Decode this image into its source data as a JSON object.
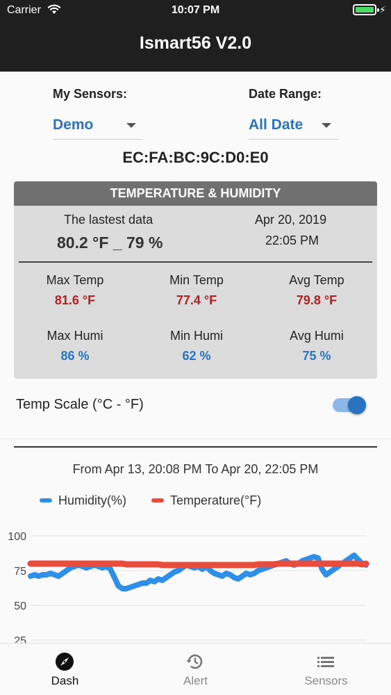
{
  "status_bar": {
    "carrier": "Carrier",
    "time": "10:07 PM"
  },
  "app": {
    "title": "Ismart56 V2.0"
  },
  "sensors": {
    "label": "My Sensors:",
    "value": "Demo"
  },
  "date_range": {
    "label": "Date Range:",
    "value": "All Date"
  },
  "device_mac": "EC:FA:BC:9C:D0:E0",
  "card": {
    "header": "TEMPERATURE & HUMIDITY",
    "latest_label": "The lastest data",
    "latest_value": "80.2 °F _ 79 %",
    "date": "Apr 20, 2019",
    "time": "22:05 PM",
    "stats": {
      "max_temp": {
        "label": "Max Temp",
        "value": "81.6 °F"
      },
      "min_temp": {
        "label": "Min Temp",
        "value": "77.4 °F"
      },
      "avg_temp": {
        "label": "Avg Temp",
        "value": "79.8 °F"
      },
      "max_humi": {
        "label": "Max Humi",
        "value": "86 %"
      },
      "min_humi": {
        "label": "Min Humi",
        "value": "62 %"
      },
      "avg_humi": {
        "label": "Avg Humi",
        "value": "75 %"
      }
    }
  },
  "temp_scale": {
    "label": "Temp Scale (°C - °F)",
    "enabled": true
  },
  "chart_range": "From Apr 13, 20:08 PM To Apr 20, 22:05 PM",
  "chart_data": {
    "type": "line",
    "y_ticks": [
      "100",
      "75",
      "50",
      "25"
    ],
    "ylim": [
      25,
      100
    ],
    "grid": true,
    "legend_placement": "top",
    "series": [
      {
        "name": "Humidity(%)",
        "color": "#2f8fe6",
        "values": [
          71,
          72,
          71,
          72,
          72,
          73,
          72,
          71,
          73,
          75,
          77,
          78,
          79,
          78,
          77,
          78,
          79,
          78,
          77,
          78,
          76,
          70,
          64,
          62,
          62,
          63,
          64,
          65,
          66,
          66,
          68,
          67,
          69,
          68,
          70,
          72,
          74,
          75,
          77,
          79,
          78,
          77,
          78,
          76,
          78,
          75,
          73,
          72,
          71,
          73,
          72,
          70,
          69,
          71,
          73,
          72,
          73,
          75,
          76,
          77,
          78,
          79,
          80,
          81,
          82,
          80,
          79,
          80,
          82,
          83,
          84,
          85,
          84,
          76,
          72,
          74,
          76,
          78,
          80,
          82,
          84,
          86,
          83,
          80,
          79
        ]
      },
      {
        "name": "Temperature(°F)",
        "color": "#e84c3d",
        "values": [
          80,
          80,
          80,
          80,
          80,
          80,
          80,
          80,
          80,
          80,
          80,
          80,
          80,
          80,
          80,
          80,
          80,
          80,
          80,
          80,
          80,
          80,
          80,
          80,
          79.5,
          79.5,
          79.5,
          79.5,
          79.5,
          79.5,
          79.5,
          79.5,
          79.5,
          79,
          79,
          79,
          79,
          79,
          79,
          79,
          79,
          79,
          79,
          79,
          79,
          79,
          79,
          79,
          79,
          79,
          79,
          79,
          79,
          79,
          79,
          79,
          79,
          79.5,
          79.5,
          79.5,
          79.5,
          79.5,
          80,
          80,
          80,
          80,
          80,
          80,
          80,
          80,
          80,
          80,
          80,
          80,
          80,
          80,
          80,
          80,
          80,
          80,
          80,
          80,
          80,
          79.5,
          80
        ]
      }
    ]
  },
  "nav": {
    "items": [
      {
        "label": "Dash",
        "icon": "compass-icon",
        "active": true
      },
      {
        "label": "Alert",
        "icon": "history-icon",
        "active": false
      },
      {
        "label": "Sensors",
        "icon": "list-icon",
        "active": false
      }
    ]
  },
  "colors": {
    "accent": "#2a73c0",
    "temp_value": "#b02020",
    "header_bg": "#1f1f1f",
    "card_header_bg": "#707070",
    "battery": "#4cd964"
  }
}
